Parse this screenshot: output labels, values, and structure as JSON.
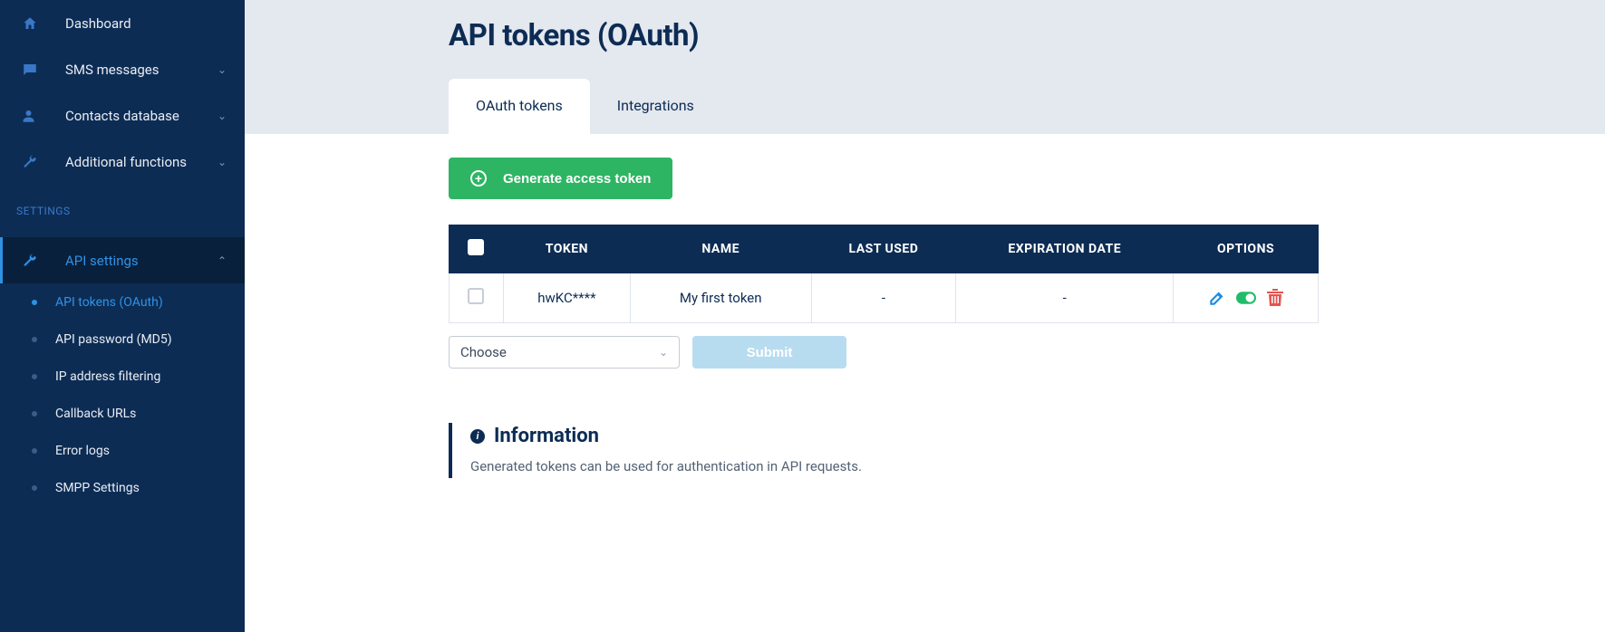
{
  "sidebar": {
    "items": [
      {
        "label": "Dashboard",
        "icon": "home"
      },
      {
        "label": "SMS messages",
        "icon": "chat",
        "chev": true
      },
      {
        "label": "Contacts database",
        "icon": "user",
        "chev": true
      },
      {
        "label": "Additional functions",
        "icon": "wrench",
        "chev": true
      }
    ],
    "section_header": "SETTINGS",
    "api_settings_label": "API settings",
    "subs": [
      {
        "label": "API tokens (OAuth)",
        "active": true
      },
      {
        "label": "API password (MD5)"
      },
      {
        "label": "IP address filtering"
      },
      {
        "label": "Callback URLs"
      },
      {
        "label": "Error logs"
      },
      {
        "label": "SMPP Settings"
      }
    ]
  },
  "page": {
    "title": "API tokens (OAuth)",
    "tabs": [
      {
        "label": "OAuth tokens",
        "active": true
      },
      {
        "label": "Integrations"
      }
    ]
  },
  "generate_button": "Generate access token",
  "table": {
    "headers": [
      "TOKEN",
      "NAME",
      "LAST USED",
      "EXPIRATION DATE",
      "OPTIONS"
    ],
    "row": {
      "token": "hwKC****",
      "name": "My first token",
      "last_used": "-",
      "expiration": "-"
    }
  },
  "choose_label": "Choose",
  "submit_label": "Submit",
  "info": {
    "title": "Information",
    "text": "Generated tokens can be used for authentication in API requests."
  }
}
